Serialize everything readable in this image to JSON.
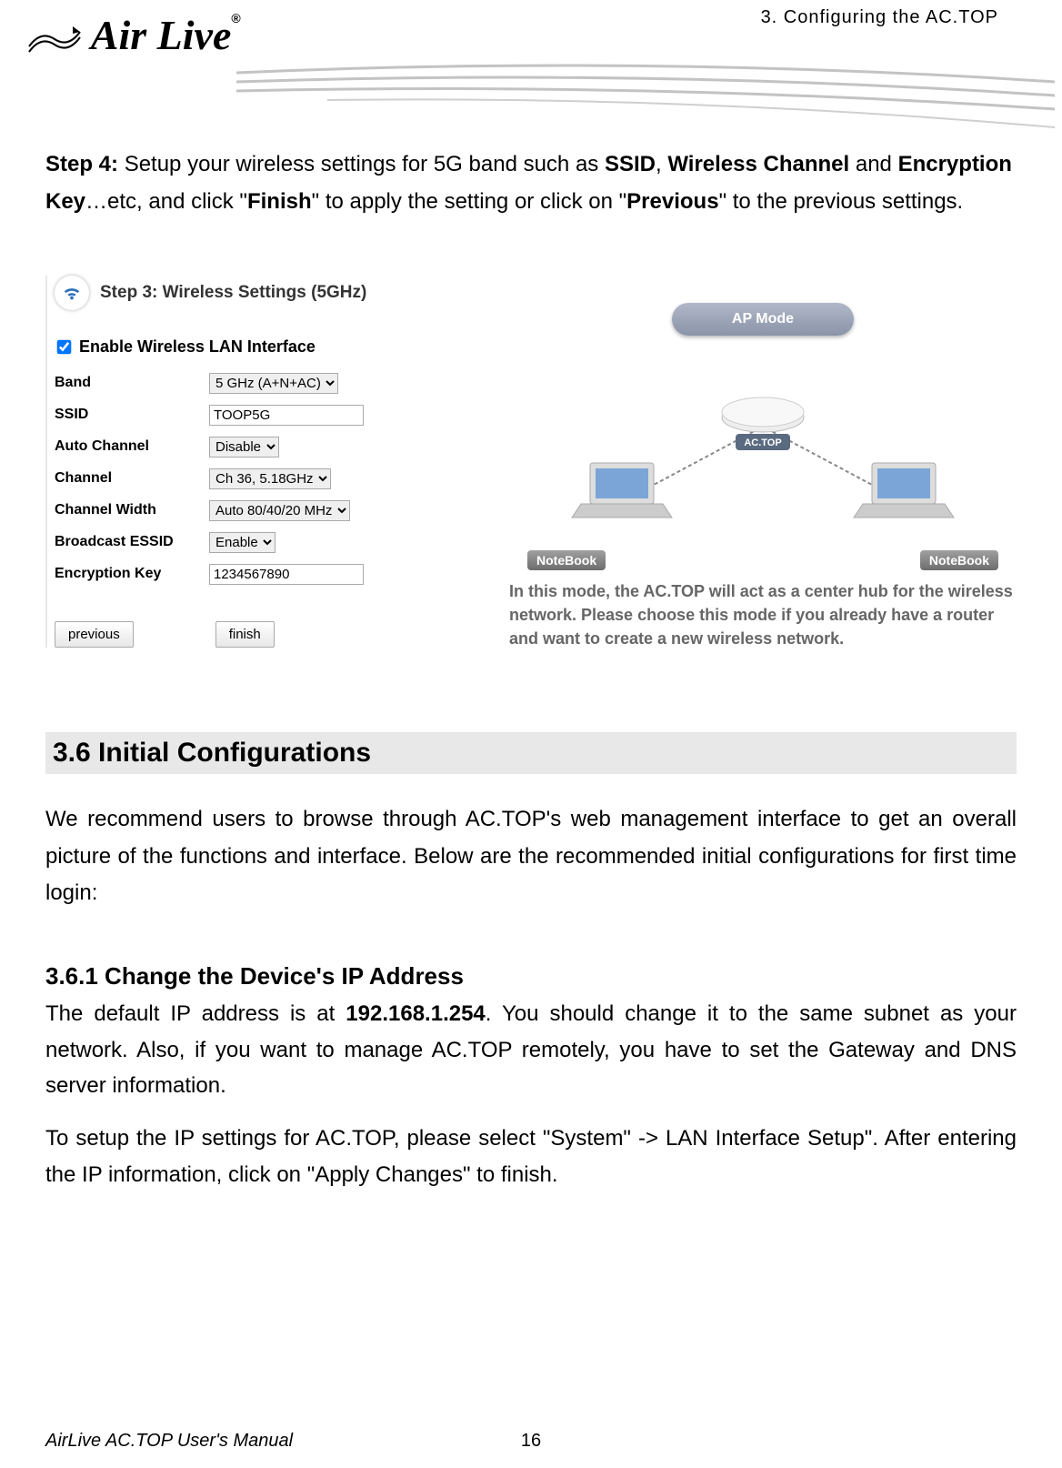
{
  "header": {
    "chapter": "3. Configuring the AC.TOP",
    "logo_text": "Air Live",
    "logo_reg": "®"
  },
  "step4": {
    "prefix": "Step 4: ",
    "text_a": "Setup your wireless settings for 5G band such as ",
    "b1": "SSID",
    "sep1": ", ",
    "b2": "Wireless Channel",
    "mid1": " and ",
    "b3": "Encryption Key",
    "mid2": "…etc, and click \"",
    "b4": "Finish",
    "mid3": "\" to apply the setting or click on \"",
    "b5": "Previous",
    "mid4": "\" to the previous settings."
  },
  "wizard": {
    "title": "Step 3: Wireless Settings (5GHz)",
    "enable_label": "Enable Wireless LAN Interface",
    "enable_checked": true,
    "rows": {
      "band": {
        "label": "Band",
        "value": "5 GHz (A+N+AC)"
      },
      "ssid": {
        "label": "SSID",
        "value": "TOOP5G"
      },
      "auto_channel": {
        "label": "Auto Channel",
        "value": "Disable"
      },
      "channel": {
        "label": "Channel",
        "value": "Ch 36, 5.18GHz"
      },
      "channel_width": {
        "label": "Channel Width",
        "value": "Auto 80/40/20 MHz"
      },
      "broadcast": {
        "label": "Broadcast ESSID",
        "value": "Enable"
      },
      "encryption": {
        "label": "Encryption Key",
        "value": "1234567890"
      }
    },
    "previous_btn": "previous",
    "finish_btn": "finish"
  },
  "diagram": {
    "mode_btn": "AP Mode",
    "device_label": "AC.TOP",
    "notebook_label": "NoteBook",
    "desc": "In this mode, the AC.TOP will act as a center hub for the wireless network. Please choose this mode if you already have a router and want to create a new wireless network."
  },
  "section36": {
    "title": "3.6 Initial Configurations",
    "para": "We recommend users to browse through AC.TOP's web management interface to get an overall picture of the functions and interface. Below are the recommended initial configurations for first time login:"
  },
  "section361": {
    "title": "3.6.1 Change the Device's IP Address",
    "p1a": "The default IP address is at ",
    "ip": "192.168.1.254",
    "p1b": ". You should change it to the same subnet as your network. Also, if you want to manage AC.TOP remotely, you have to set the Gateway and DNS server information.",
    "p2": "To setup the IP settings for AC.TOP, please select \"System\" -> LAN Interface Setup\". After entering the IP information, click on \"Apply Changes\" to finish."
  },
  "footer": {
    "left": "AirLive AC.TOP User's Manual",
    "center": "16"
  }
}
